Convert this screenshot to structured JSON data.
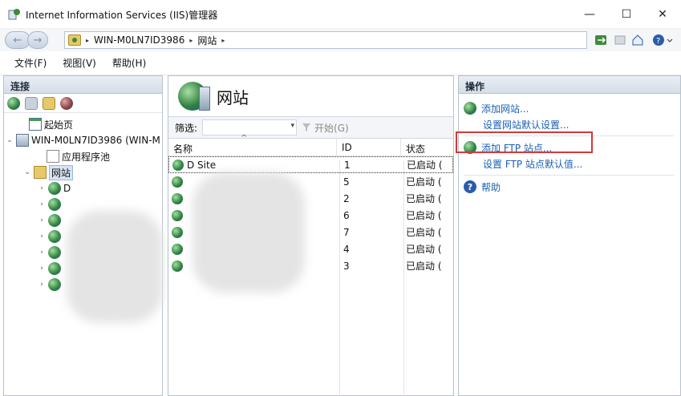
{
  "window": {
    "title": "Internet Information Services (IIS)管理器",
    "controls": {
      "minimize": "—",
      "maximize": "☐",
      "close": "✕"
    }
  },
  "address": {
    "back": "←",
    "forward": "→",
    "crumbs": [
      "WIN-M0LN7ID3986",
      "网站"
    ],
    "separator": "▸"
  },
  "menu": [
    "文件(F)",
    "视图(V)",
    "帮助(H)"
  ],
  "connections": {
    "header": "连接",
    "tree": [
      {
        "label": "起始页",
        "level": 1,
        "toggle": "",
        "icon": "start-page"
      },
      {
        "label": "WIN-M0LN7ID3986 (WIN-M",
        "level": 0,
        "toggle": "⌄",
        "icon": "server"
      },
      {
        "label": "应用程序池",
        "level": 2,
        "toggle": "",
        "icon": "app-pool"
      },
      {
        "label": "网站",
        "level": 1,
        "toggle": "⌄",
        "icon": "sites-folder",
        "selected": true
      },
      {
        "label": "D",
        "level": 2,
        "toggle": "›",
        "icon": "globe"
      },
      {
        "label": "",
        "level": 2,
        "toggle": "›",
        "icon": "globe"
      },
      {
        "label": "",
        "level": 2,
        "toggle": "›",
        "icon": "globe"
      },
      {
        "label": "",
        "level": 2,
        "toggle": "›",
        "icon": "globe"
      },
      {
        "label": "",
        "level": 2,
        "toggle": "›",
        "icon": "globe"
      },
      {
        "label": "",
        "level": 2,
        "toggle": "›",
        "icon": "globe"
      },
      {
        "label": "",
        "level": 2,
        "toggle": "›",
        "icon": "globe"
      }
    ]
  },
  "sites": {
    "title": "网站",
    "filter_label": "筛选:",
    "start_label": "开始(G)",
    "columns": {
      "name": "名称",
      "id": "ID",
      "state": "状态"
    },
    "rows": [
      {
        "name": "D              Site",
        "id": "1",
        "state": "已启动 ("
      },
      {
        "name": "",
        "id": "5",
        "state": "已启动 ("
      },
      {
        "name": "",
        "id": "2",
        "state": "已启动 ("
      },
      {
        "name": "",
        "id": "6",
        "state": "已启动 ("
      },
      {
        "name": "",
        "id": "7",
        "state": "已启动 ("
      },
      {
        "name": "",
        "id": "4",
        "state": "已启动 ("
      },
      {
        "name": "",
        "id": "3",
        "state": "已启动 ("
      }
    ]
  },
  "actions": {
    "header": "操作",
    "add_site": "添加网站...",
    "set_site_defaults": "设置网站默认设置...",
    "add_ftp": "添加 FTP 站点...",
    "set_ftp_defaults": "设置 FTP 站点默认值...",
    "help": "帮助"
  },
  "colors": {
    "link": "#1a5fb4",
    "highlight": "#d23a3a",
    "panel_header": "#d6dee8"
  }
}
